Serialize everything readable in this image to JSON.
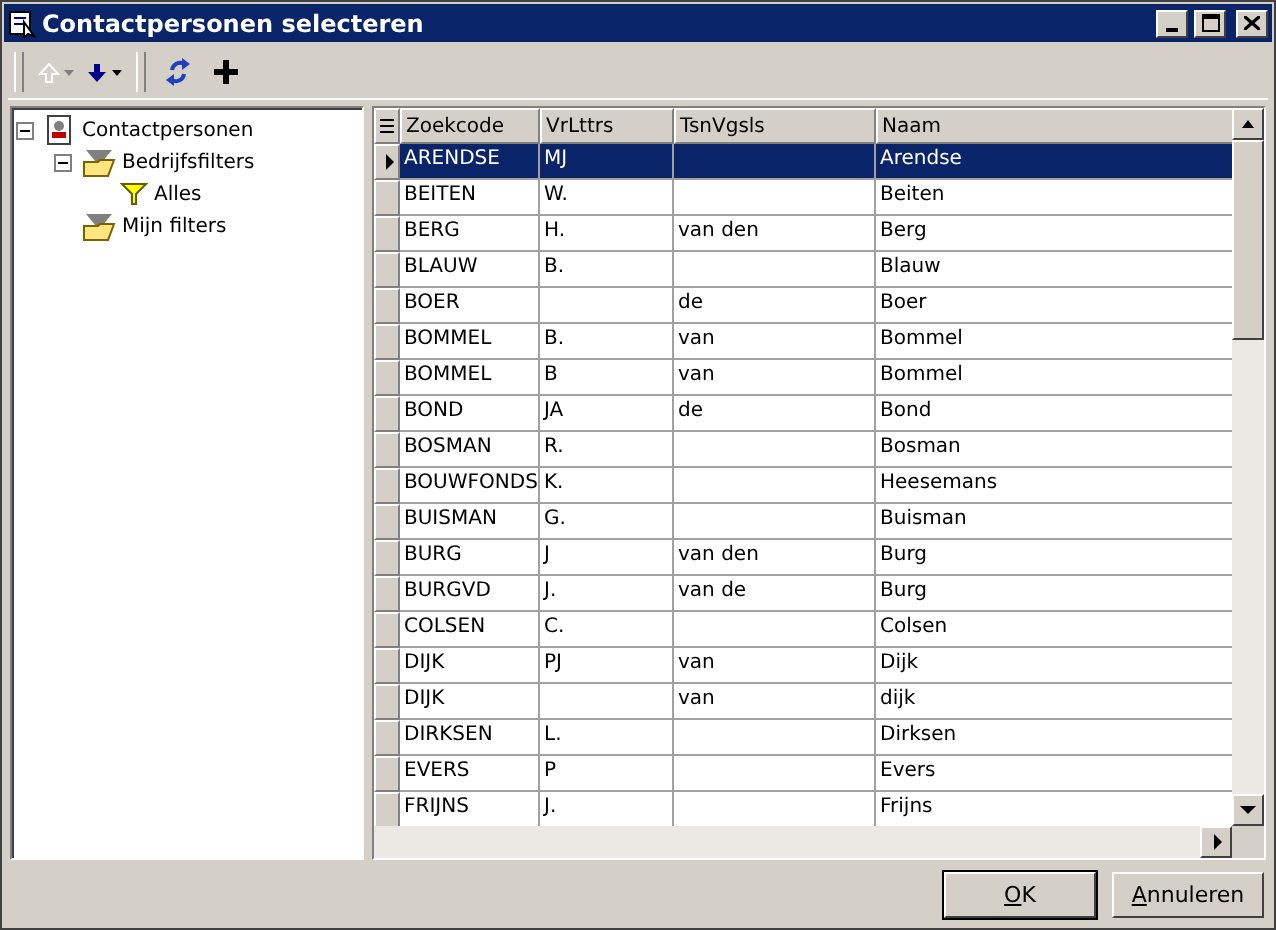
{
  "window": {
    "title": "Contactpersonen selecteren"
  },
  "toolbar": [
    {
      "kind": "up",
      "disabled": true
    },
    {
      "kind": "down",
      "disabled": false
    },
    {
      "kind": "refresh",
      "disabled": false
    },
    {
      "kind": "add",
      "disabled": false
    }
  ],
  "tree": [
    {
      "label": "Contactpersonen",
      "kind": "root",
      "expanded": true,
      "children": [
        {
          "label": "Bedrijfsfilters",
          "kind": "folder",
          "expanded": true,
          "children": [
            {
              "label": "Alles",
              "kind": "filter"
            }
          ]
        },
        {
          "label": "Mijn filters",
          "kind": "folder"
        }
      ]
    }
  ],
  "table": {
    "columns": [
      "Zoekcode",
      "VrLttrs",
      "TsnVgsls",
      "Naam"
    ],
    "rows": [
      {
        "cells": [
          "ARENDSE",
          "MJ",
          "",
          "Arendse"
        ],
        "selected": true
      },
      {
        "cells": [
          "BEITEN",
          "W.",
          "",
          "Beiten"
        ],
        "selected": false
      },
      {
        "cells": [
          "BERG",
          "H.",
          "van den",
          "Berg"
        ],
        "selected": false
      },
      {
        "cells": [
          "BLAUW",
          "B.",
          "",
          "Blauw"
        ],
        "selected": false
      },
      {
        "cells": [
          "BOER",
          "",
          "de",
          "Boer"
        ],
        "selected": false
      },
      {
        "cells": [
          "BOMMEL",
          "B.",
          "van",
          "Bommel"
        ],
        "selected": false
      },
      {
        "cells": [
          "BOMMEL",
          "B",
          "van",
          "Bommel"
        ],
        "selected": false
      },
      {
        "cells": [
          "BOND",
          "JA",
          "de",
          "Bond"
        ],
        "selected": false
      },
      {
        "cells": [
          "BOSMAN",
          "R.",
          "",
          "Bosman"
        ],
        "selected": false
      },
      {
        "cells": [
          "BOUWFONDS",
          "K.",
          "",
          "Heesemans"
        ],
        "selected": false
      },
      {
        "cells": [
          "BUISMAN",
          "G.",
          "",
          "Buisman"
        ],
        "selected": false
      },
      {
        "cells": [
          "BURG",
          "J",
          "van den",
          "Burg"
        ],
        "selected": false
      },
      {
        "cells": [
          "BURGVD",
          "J.",
          "van de",
          "Burg"
        ],
        "selected": false
      },
      {
        "cells": [
          "COLSEN",
          "C.",
          "",
          "Colsen"
        ],
        "selected": false
      },
      {
        "cells": [
          "DIJK",
          "PJ",
          "van",
          "Dijk"
        ],
        "selected": false
      },
      {
        "cells": [
          "DIJK",
          "",
          "van",
          "dijk"
        ],
        "selected": false
      },
      {
        "cells": [
          "DIRKSEN",
          "L.",
          "",
          "Dirksen"
        ],
        "selected": false
      },
      {
        "cells": [
          "EVERS",
          "P",
          "",
          "Evers"
        ],
        "selected": false
      },
      {
        "cells": [
          "FRIJNS",
          "J.",
          "",
          "Frijns"
        ],
        "selected": false
      }
    ]
  },
  "buttons": [
    "OK",
    "Annuleren"
  ]
}
